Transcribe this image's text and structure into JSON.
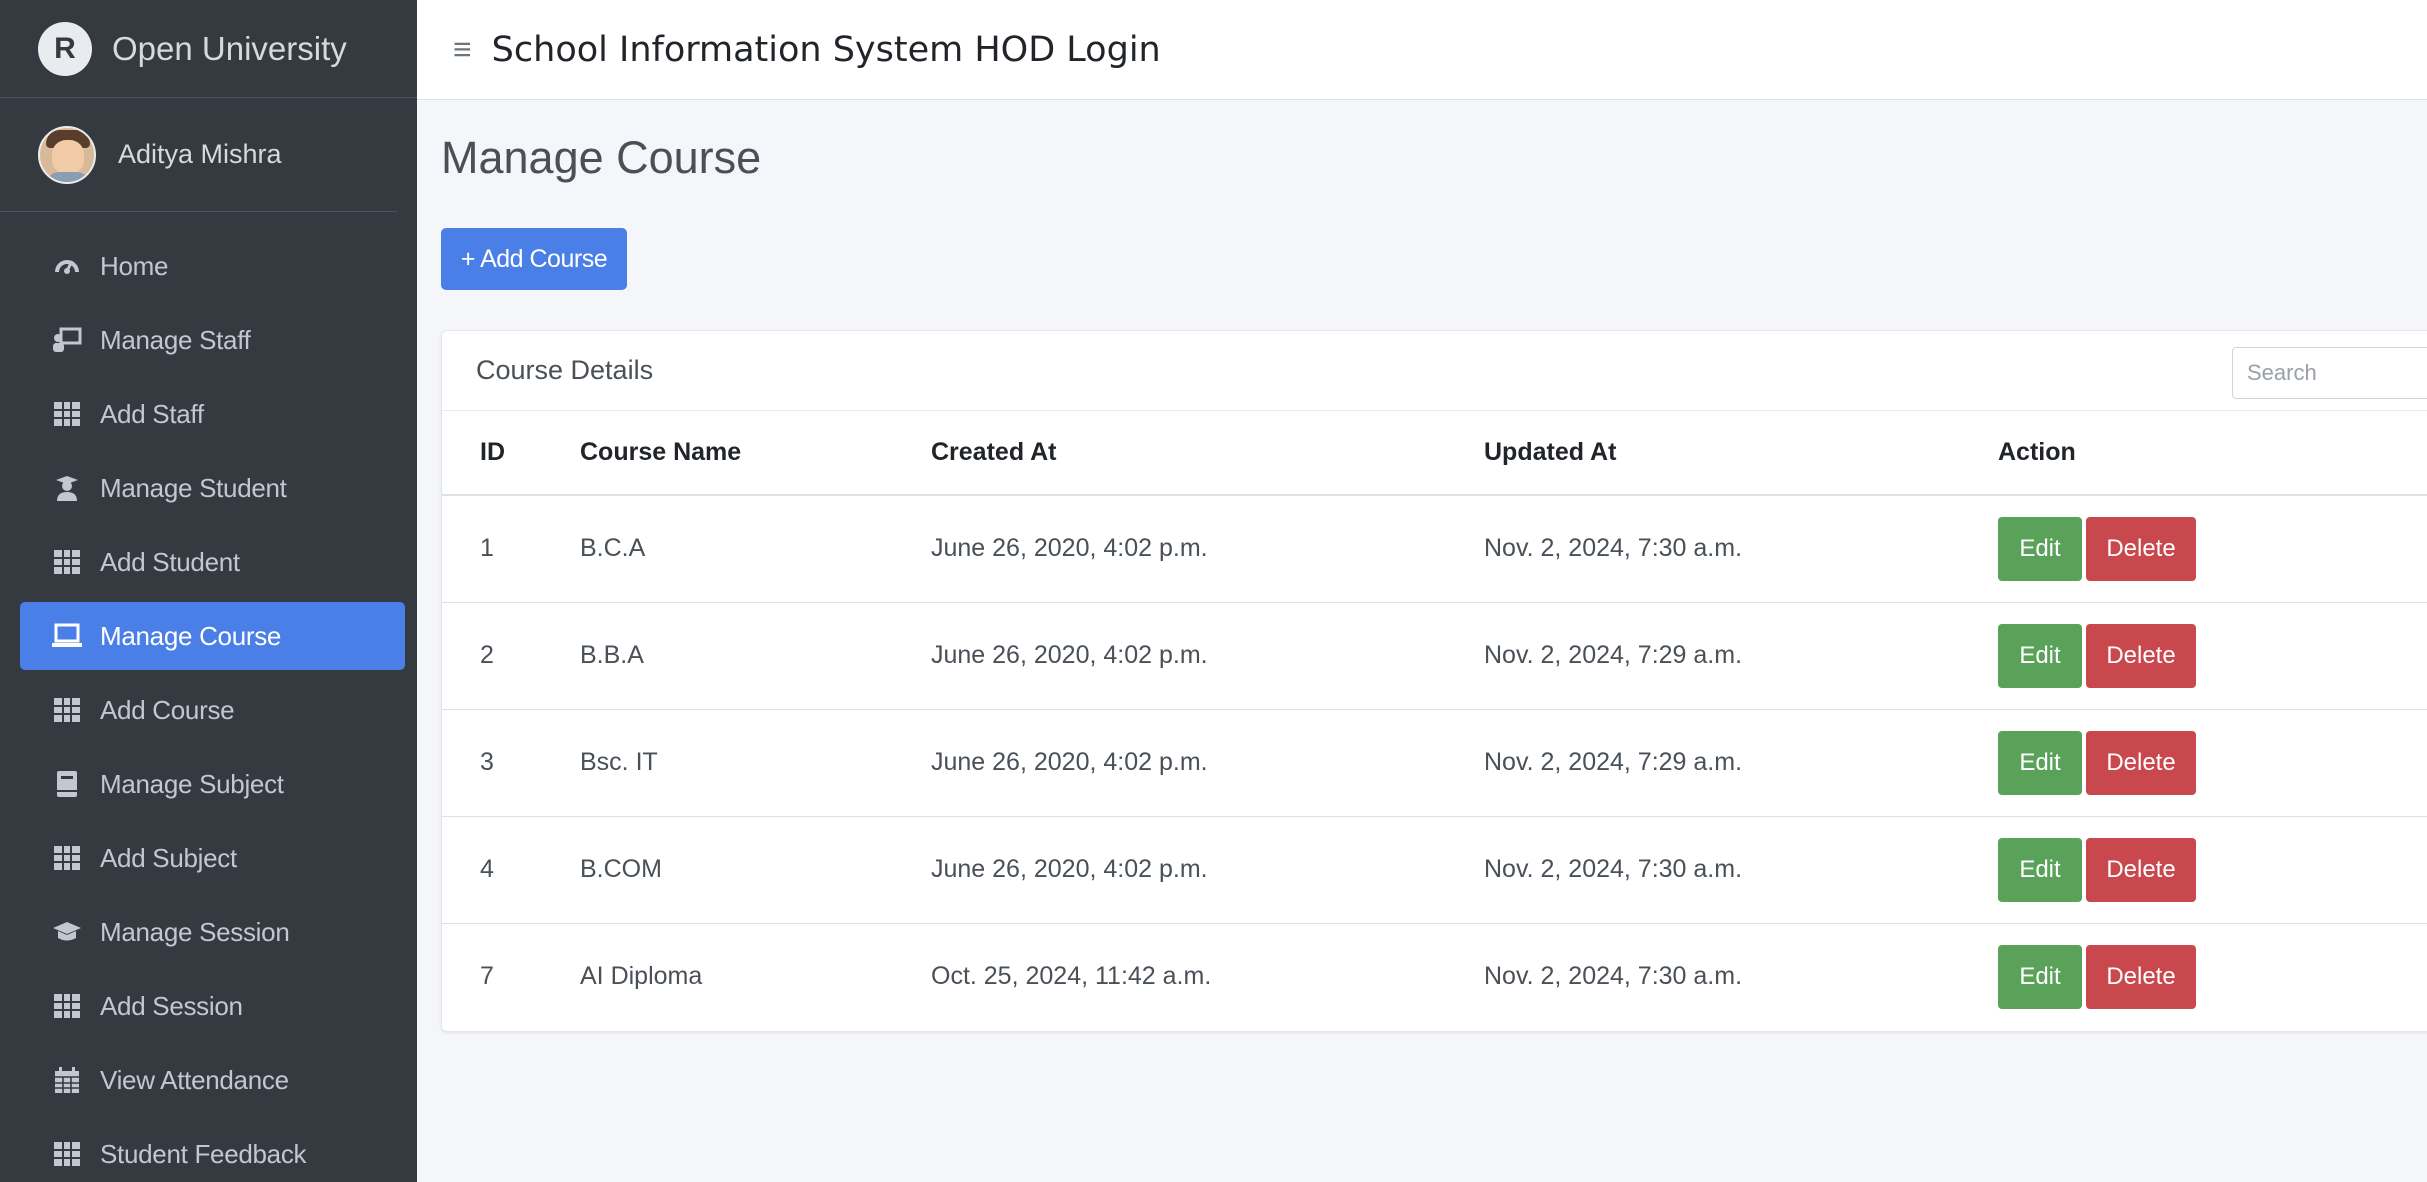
{
  "brand": {
    "name": "Open University",
    "logo_letter": "R"
  },
  "user": {
    "name": "Aditya Mishra"
  },
  "sidebar": {
    "items": [
      {
        "label": "Home",
        "icon": "dashboard-icon"
      },
      {
        "label": "Manage Staff",
        "icon": "chalkboard-teacher-icon"
      },
      {
        "label": "Add Staff",
        "icon": "grid-icon"
      },
      {
        "label": "Manage Student",
        "icon": "user-graduate-icon"
      },
      {
        "label": "Add Student",
        "icon": "grid-icon"
      },
      {
        "label": "Manage Course",
        "icon": "laptop-icon",
        "active": true
      },
      {
        "label": "Add Course",
        "icon": "grid-icon"
      },
      {
        "label": "Manage Subject",
        "icon": "book-icon"
      },
      {
        "label": "Add Subject",
        "icon": "grid-icon"
      },
      {
        "label": "Manage Session",
        "icon": "graduation-cap-icon"
      },
      {
        "label": "Add Session",
        "icon": "grid-icon"
      },
      {
        "label": "View Attendance",
        "icon": "calendar-icon"
      },
      {
        "label": "Student Feedback",
        "icon": "grid-icon"
      }
    ]
  },
  "topbar": {
    "title": "School Information System HOD Login",
    "menu_glyph": "≡"
  },
  "main": {
    "page_title": "Manage Course",
    "add_button": "+ Add Course",
    "card_title": "Course Details",
    "search_placeholder": "Search",
    "table": {
      "headers": [
        "ID",
        "Course Name",
        "Created At",
        "Updated At",
        "Action"
      ],
      "rows": [
        {
          "id": "1",
          "name": "B.C.A",
          "created": "June 26, 2020, 4:02 p.m.",
          "updated": "Nov. 2, 2024, 7:30 a.m."
        },
        {
          "id": "2",
          "name": "B.B.A",
          "created": "June 26, 2020, 4:02 p.m.",
          "updated": "Nov. 2, 2024, 7:29 a.m."
        },
        {
          "id": "3",
          "name": "Bsc. IT",
          "created": "June 26, 2020, 4:02 p.m.",
          "updated": "Nov. 2, 2024, 7:29 a.m."
        },
        {
          "id": "4",
          "name": "B.COM",
          "created": "June 26, 2020, 4:02 p.m.",
          "updated": "Nov. 2, 2024, 7:30 a.m."
        },
        {
          "id": "7",
          "name": "AI Diploma",
          "created": "Oct. 25, 2024, 11:42 a.m.",
          "updated": "Nov. 2, 2024, 7:30 a.m."
        }
      ],
      "edit_label": "Edit",
      "delete_label": "Delete"
    }
  },
  "colors": {
    "sidebar_bg": "#343a40",
    "primary": "#4a7fe8",
    "edit": "#5aa25a",
    "delete": "#c9484d"
  }
}
